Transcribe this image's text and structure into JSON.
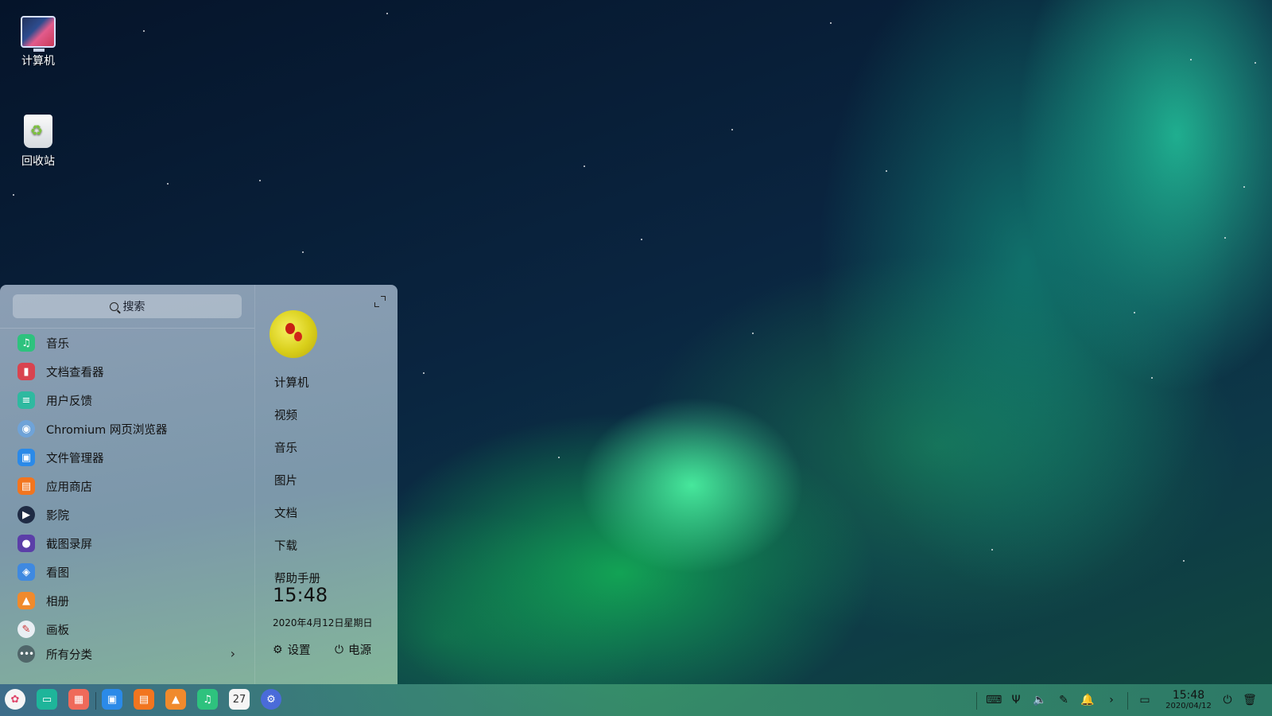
{
  "desktop": {
    "computer_label": "计算机",
    "trash_label": "回收站"
  },
  "launcher": {
    "search_placeholder": "搜索",
    "apps": [
      {
        "label": "音乐",
        "icon": "music-icon",
        "color": "#2ec27e"
      },
      {
        "label": "文档查看器",
        "icon": "document-viewer-icon",
        "color": "#d9434f"
      },
      {
        "label": "用户反馈",
        "icon": "feedback-icon",
        "color": "#2fb9a0"
      },
      {
        "label": "Chromium 网页浏览器",
        "icon": "chromium-icon",
        "color": "#6fa3d8"
      },
      {
        "label": "文件管理器",
        "icon": "file-manager-icon",
        "color": "#2b8ae8"
      },
      {
        "label": "应用商店",
        "icon": "app-store-icon",
        "color": "#f2751f"
      },
      {
        "label": "影院",
        "icon": "movie-icon",
        "color": "#1f2b44"
      },
      {
        "label": "截图录屏",
        "icon": "screenshot-icon",
        "color": "#5b3ea8"
      },
      {
        "label": "看图",
        "icon": "image-viewer-icon",
        "color": "#3f89e0"
      },
      {
        "label": "相册",
        "icon": "album-icon",
        "color": "#f08a2c"
      },
      {
        "label": "画板",
        "icon": "draw-icon",
        "color": "#e9eef3"
      }
    ],
    "all_categories": "所有分类",
    "places": [
      "计算机",
      "视频",
      "音乐",
      "图片",
      "文档",
      "下载",
      "帮助手册"
    ],
    "time": "15:48",
    "date": "2020年4月12日星期日",
    "settings_label": "设置",
    "power_label": "电源"
  },
  "taskbar": {
    "apps": [
      {
        "icon": "launcher-icon",
        "color": "#f5f5f5"
      },
      {
        "icon": "multitask-view-icon",
        "color": "#1eb59a"
      },
      {
        "icon": "show-desktop-icon",
        "color": "#ef6a5a"
      },
      {
        "icon": "file-manager-icon",
        "color": "#2b8ae8"
      },
      {
        "icon": "app-store-icon",
        "color": "#f2751f"
      },
      {
        "icon": "album-icon",
        "color": "#f08a2c"
      },
      {
        "icon": "music-icon",
        "color": "#2ec27e"
      },
      {
        "icon": "calendar-icon",
        "color": "#f5f5f5"
      },
      {
        "icon": "control-center-icon",
        "color": "#4a6bd9"
      }
    ],
    "calendar_day": "27",
    "time": "15:48",
    "date": "2020/04/12"
  }
}
